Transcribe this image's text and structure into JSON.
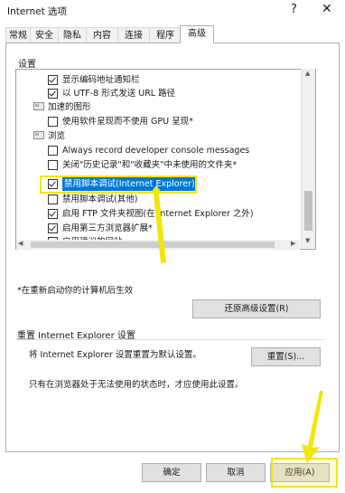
{
  "window": {
    "title": "Internet 选项",
    "help": "?",
    "close": "✕"
  },
  "tabs": [
    "常规",
    "安全",
    "隐私",
    "内容",
    "连接",
    "程序",
    "高级"
  ],
  "settings_label": "设置",
  "tree": [
    {
      "kind": "checkbox",
      "checked": true,
      "text": "显示编码地址通知栏"
    },
    {
      "kind": "checkbox",
      "checked": true,
      "text": "以 UTF-8 形式发送 URL 路径"
    },
    {
      "kind": "folder",
      "text": "加速的图形"
    },
    {
      "kind": "checkbox",
      "checked": false,
      "text": "使用软件呈现而不使用 GPU 呈现*"
    },
    {
      "kind": "folder",
      "text": "浏览"
    },
    {
      "kind": "checkbox",
      "checked": false,
      "text": "Always record developer console messages"
    },
    {
      "kind": "checkbox",
      "checked": false,
      "text": "关闭\"历史记录\"和\"收藏夹\"中未使用的文件夹*"
    },
    {
      "kind": "checkbox",
      "checked": true,
      "text": "禁用脚本调试(Internet Explorer)",
      "highlight": true
    },
    {
      "kind": "checkbox",
      "checked": false,
      "text": "禁用脚本调试(其他)"
    },
    {
      "kind": "checkbox",
      "checked": true,
      "text": "启用 FTP 文件夹视图(在 Internet Explorer 之外)"
    },
    {
      "kind": "checkbox",
      "checked": true,
      "text": "启用第三方浏览器扩展*"
    },
    {
      "kind": "checkbox",
      "checked": true,
      "text": "启用建议的网站"
    },
    {
      "kind": "checkbox",
      "checked": true,
      "text": "启用自动崩溃恢复*"
    }
  ],
  "restart_note": "*在重新启动你的计算机后生效",
  "restore_button": "还原高级设置(R)",
  "reset_group_title": "重置 Internet Explorer 设置",
  "reset_desc": "将 Internet Explorer 设置重置为默认设置。",
  "reset_button": "重置(S)...",
  "reset_warning": "只有在浏览器处于无法使用的状态时，才应使用此设置。",
  "footer": {
    "ok": "确定",
    "cancel": "取消",
    "apply": "应用(A)"
  },
  "colors": {
    "selection": "#0078d7",
    "annotation": "#f3e60a"
  }
}
